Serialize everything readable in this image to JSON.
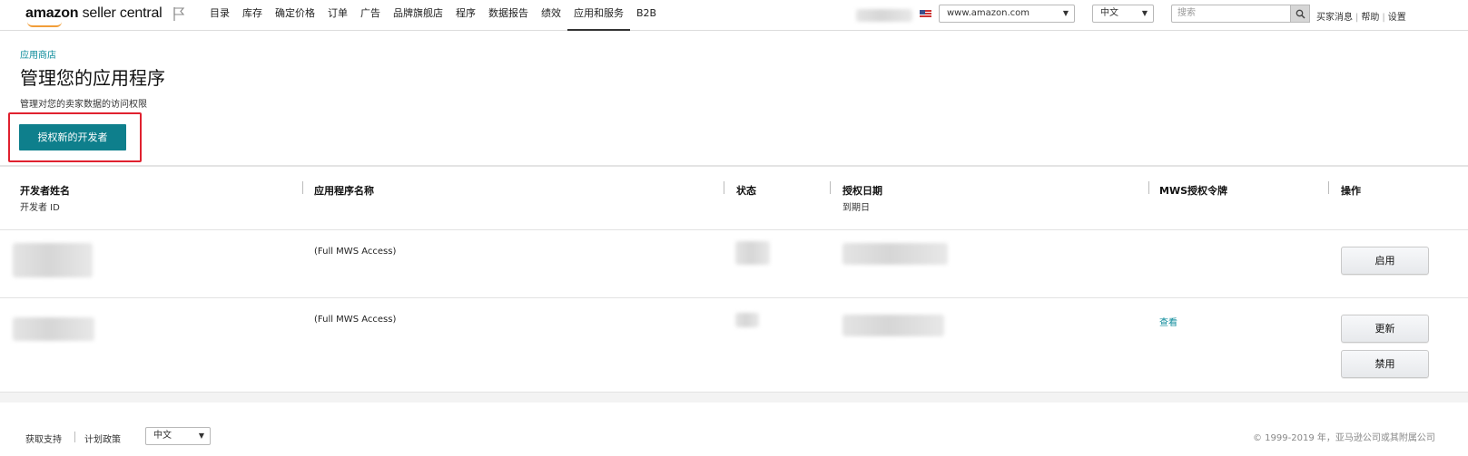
{
  "header": {
    "logo_amazon": "amazon",
    "logo_product": "seller central",
    "nav_items": [
      "目录",
      "库存",
      "确定价格",
      "订单",
      "广告",
      "品牌旗舰店",
      "程序",
      "数据报告",
      "绩效",
      "应用和服务",
      "B2B"
    ],
    "active_nav": "应用和服务",
    "marketplace_select": "www.amazon.com",
    "language_select": "中文",
    "search_placeholder": "搜索",
    "top_links": [
      "买家消息",
      "帮助",
      "设置"
    ]
  },
  "page": {
    "breadcrumb": "应用商店",
    "title": "管理您的应用程序",
    "description": "管理对您的卖家数据的访问权限",
    "authorize_button": "授权新的开发者"
  },
  "table": {
    "columns": [
      {
        "label": "开发者姓名",
        "sub": "开发者 ID"
      },
      {
        "label": "应用程序名称",
        "sub": ""
      },
      {
        "label": "状态",
        "sub": ""
      },
      {
        "label": "授权日期",
        "sub": "到期日"
      },
      {
        "label": "MWS授权令牌",
        "sub": ""
      },
      {
        "label": "操作",
        "sub": ""
      }
    ],
    "rows": [
      {
        "app_name": "(Full MWS Access)",
        "token_link": "",
        "actions": [
          "启用"
        ]
      },
      {
        "app_name": "(Full MWS Access)",
        "token_link": "查看",
        "actions": [
          "更新",
          "禁用"
        ]
      }
    ]
  },
  "footer": {
    "links": [
      "获取支持",
      "计划政策"
    ],
    "language_select": "中文",
    "copyright": "© 1999-2019 年，亚马逊公司或其附属公司"
  },
  "colors": {
    "primary_button": "#0e7f8c",
    "link": "#0a8a9a",
    "highlight": "#e0212f"
  }
}
